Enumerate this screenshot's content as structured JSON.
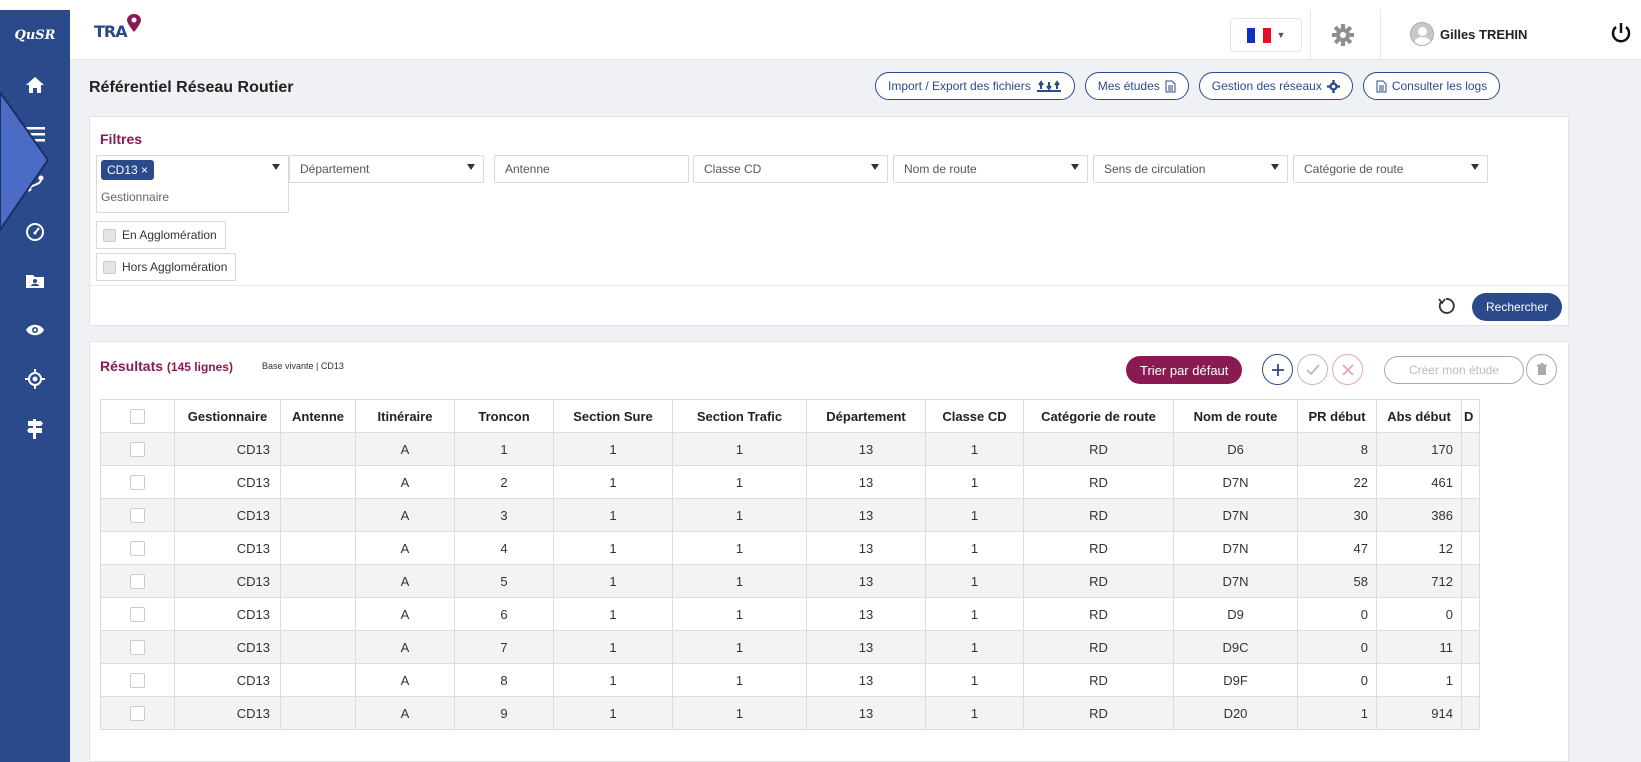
{
  "app": {
    "logo_text": "QuSR",
    "brand": "TRA"
  },
  "sidebar": {
    "items": [
      {
        "name": "home-icon"
      },
      {
        "name": "menu-icon"
      },
      {
        "name": "route-icon"
      },
      {
        "name": "gauge-icon"
      },
      {
        "name": "contact-folder-icon"
      },
      {
        "name": "eye-icon"
      },
      {
        "name": "target-icon"
      },
      {
        "name": "road-sign-icon"
      }
    ]
  },
  "header": {
    "user_name": "Gilles TREHIN",
    "language": "FR",
    "colors": {
      "brand": "#2b4a8b",
      "accent": "#8a1a52"
    }
  },
  "page": {
    "title": "Référentiel Réseau Routier",
    "actions": {
      "import_export": "Import / Export des fichiers",
      "mes_etudes": "Mes études",
      "gestion_reseaux": "Gestion des réseaux",
      "consulter_logs": "Consulter les logs"
    }
  },
  "filters": {
    "title": "Filtres",
    "gestionnaire_tag": "CD13 ×",
    "gestionnaire_placeholder": "Gestionnaire",
    "departement": "Département",
    "antenne": "Antenne",
    "classe_cd": "Classe CD",
    "nom_route": "Nom de route",
    "sens": "Sens de circulation",
    "categorie": "Catégorie de route",
    "en_agglo": "En Agglomération",
    "hors_agglo": "Hors Agglomération",
    "search": "Rechercher"
  },
  "results": {
    "title": "Résultats",
    "count": "(145 lignes)",
    "meta": "Base vivante  |  CD13",
    "sort_default": "Trier par défaut",
    "create_study": "Créer mon étude",
    "columns": [
      "",
      "Gestionnaire",
      "Antenne",
      "Itinéraire",
      "Troncon",
      "Section Sure",
      "Section Trafic",
      "Département",
      "Classe CD",
      "Catégorie de route",
      "Nom de route",
      "PR début",
      "Abs début",
      "D"
    ],
    "rows": [
      {
        "gest": "CD13",
        "ant": "",
        "iti": "A",
        "tron": "1",
        "sure": "1",
        "traf": "1",
        "dep": "13",
        "cls": "1",
        "cat": "RD",
        "nom": "D6",
        "pr": "8",
        "abs": "170"
      },
      {
        "gest": "CD13",
        "ant": "",
        "iti": "A",
        "tron": "2",
        "sure": "1",
        "traf": "1",
        "dep": "13",
        "cls": "1",
        "cat": "RD",
        "nom": "D7N",
        "pr": "22",
        "abs": "461"
      },
      {
        "gest": "CD13",
        "ant": "",
        "iti": "A",
        "tron": "3",
        "sure": "1",
        "traf": "1",
        "dep": "13",
        "cls": "1",
        "cat": "RD",
        "nom": "D7N",
        "pr": "30",
        "abs": "386"
      },
      {
        "gest": "CD13",
        "ant": "",
        "iti": "A",
        "tron": "4",
        "sure": "1",
        "traf": "1",
        "dep": "13",
        "cls": "1",
        "cat": "RD",
        "nom": "D7N",
        "pr": "47",
        "abs": "12"
      },
      {
        "gest": "CD13",
        "ant": "",
        "iti": "A",
        "tron": "5",
        "sure": "1",
        "traf": "1",
        "dep": "13",
        "cls": "1",
        "cat": "RD",
        "nom": "D7N",
        "pr": "58",
        "abs": "712"
      },
      {
        "gest": "CD13",
        "ant": "",
        "iti": "A",
        "tron": "6",
        "sure": "1",
        "traf": "1",
        "dep": "13",
        "cls": "1",
        "cat": "RD",
        "nom": "D9",
        "pr": "0",
        "abs": "0"
      },
      {
        "gest": "CD13",
        "ant": "",
        "iti": "A",
        "tron": "7",
        "sure": "1",
        "traf": "1",
        "dep": "13",
        "cls": "1",
        "cat": "RD",
        "nom": "D9C",
        "pr": "0",
        "abs": "11"
      },
      {
        "gest": "CD13",
        "ant": "",
        "iti": "A",
        "tron": "8",
        "sure": "1",
        "traf": "1",
        "dep": "13",
        "cls": "1",
        "cat": "RD",
        "nom": "D9F",
        "pr": "0",
        "abs": "1"
      },
      {
        "gest": "CD13",
        "ant": "",
        "iti": "A",
        "tron": "9",
        "sure": "1",
        "traf": "1",
        "dep": "13",
        "cls": "1",
        "cat": "RD",
        "nom": "D20",
        "pr": "1",
        "abs": "914"
      }
    ]
  }
}
